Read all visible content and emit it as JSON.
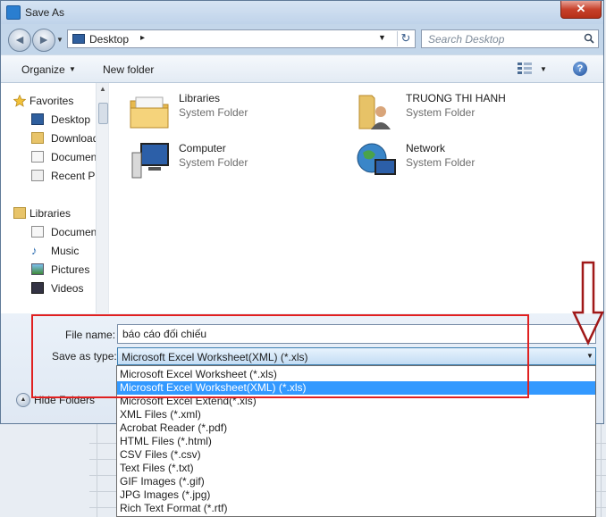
{
  "window": {
    "title": "Save As",
    "close_glyph": "✕"
  },
  "nav": {
    "back_glyph": "◄",
    "forward_glyph": "►",
    "address": {
      "icon": "desktop-icon",
      "location": "Desktop",
      "separator": "▸"
    },
    "refresh_glyph": "↻",
    "search": {
      "placeholder": "Search Desktop",
      "icon": "search-icon"
    }
  },
  "toolbar": {
    "organize": "Organize",
    "new_folder": "New folder",
    "help": "?"
  },
  "sidebar": {
    "items": [
      {
        "label": "Favorites",
        "icon": "star-icon"
      },
      {
        "label": "Desktop",
        "icon": "desktop-icon"
      },
      {
        "label": "Downloads",
        "icon": "downloads-icon"
      },
      {
        "label": "Documents",
        "icon": "documents-icon"
      },
      {
        "label": "Recent Places",
        "icon": "recent-places-icon"
      },
      {
        "label": "Libraries",
        "icon": "libraries-icon"
      },
      {
        "label": "Documents",
        "icon": "documents-icon"
      },
      {
        "label": "Music",
        "icon": "music-icon"
      },
      {
        "label": "Pictures",
        "icon": "pictures-icon"
      },
      {
        "label": "Videos",
        "icon": "videos-icon"
      }
    ]
  },
  "content": {
    "items": [
      {
        "name": "Libraries",
        "type": "System Folder",
        "icon": "libraries-folder-icon"
      },
      {
        "name": "TRUONG THI HANH",
        "type": "System Folder",
        "icon": "user-folder-icon"
      },
      {
        "name": "Computer",
        "type": "System Folder",
        "icon": "computer-icon"
      },
      {
        "name": "Network",
        "type": "System Folder",
        "icon": "network-icon"
      }
    ]
  },
  "save": {
    "file_name_label": "File name:",
    "file_name_value": "báo cáo đối chiếu",
    "save_type_label": "Save as type:",
    "save_type_value": "Microsoft Excel Worksheet(XML) (*.xls)",
    "hide_folders": "Hide Folders"
  },
  "type_options": [
    "Microsoft Excel Worksheet (*.xls)",
    "Microsoft Excel Worksheet(XML) (*.xls)",
    "Microsoft Excel Extend(*.xls)",
    "XML Files (*.xml)",
    "Acrobat Reader (*.pdf)",
    "HTML Files (*.html)",
    "CSV Files (*.csv)",
    "Text Files (*.txt)",
    "GIF Images (*.gif)",
    "JPG Images (*.jpg)",
    "Rich Text Format (*.rtf)"
  ],
  "selected_option_index": 1,
  "colors": {
    "highlight": "#3399ff",
    "annotation": "#e02020"
  }
}
